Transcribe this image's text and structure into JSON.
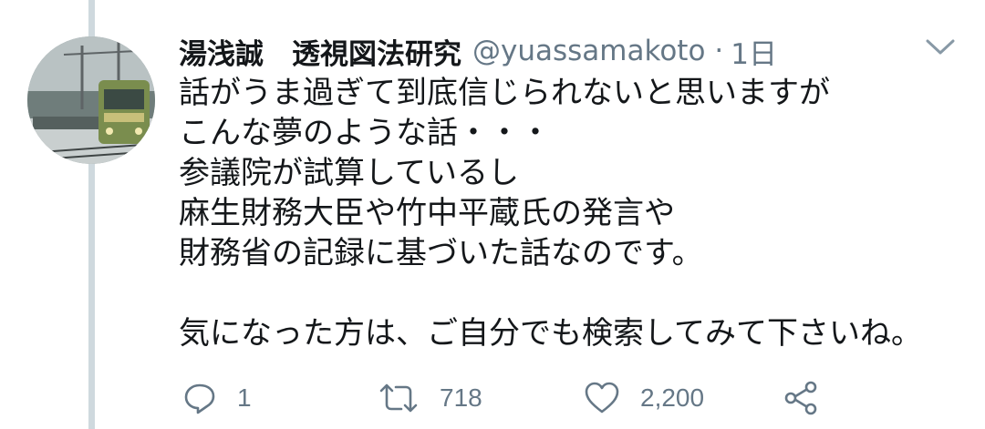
{
  "tweet": {
    "author": {
      "display_name": "湯浅誠　透視図法研究",
      "handle": "@yuassamakoto",
      "separator": "·",
      "time": "1日",
      "avatar_icon": "avatar-train-photo"
    },
    "menu_icon": "chevron-down-icon",
    "lines": [
      "話がうま過ぎて到底信じられないと思いますが",
      "こんな夢のような話・・・",
      "参議院が試算しているし",
      "麻生財務大臣や竹中平蔵氏の発言や",
      "財務省の記録に基づいた話なのです。",
      "",
      "気になった方は、ご自分でも検索してみて下さいね。"
    ],
    "actions": {
      "reply": {
        "icon": "reply-icon",
        "count": "1"
      },
      "retweet": {
        "icon": "retweet-icon",
        "count": "718"
      },
      "like": {
        "icon": "heart-icon",
        "count": "2,200"
      },
      "share": {
        "icon": "share-icon"
      }
    }
  },
  "colors": {
    "text": "#14171a",
    "secondary": "#657786",
    "thread_line": "#cfd9de"
  }
}
